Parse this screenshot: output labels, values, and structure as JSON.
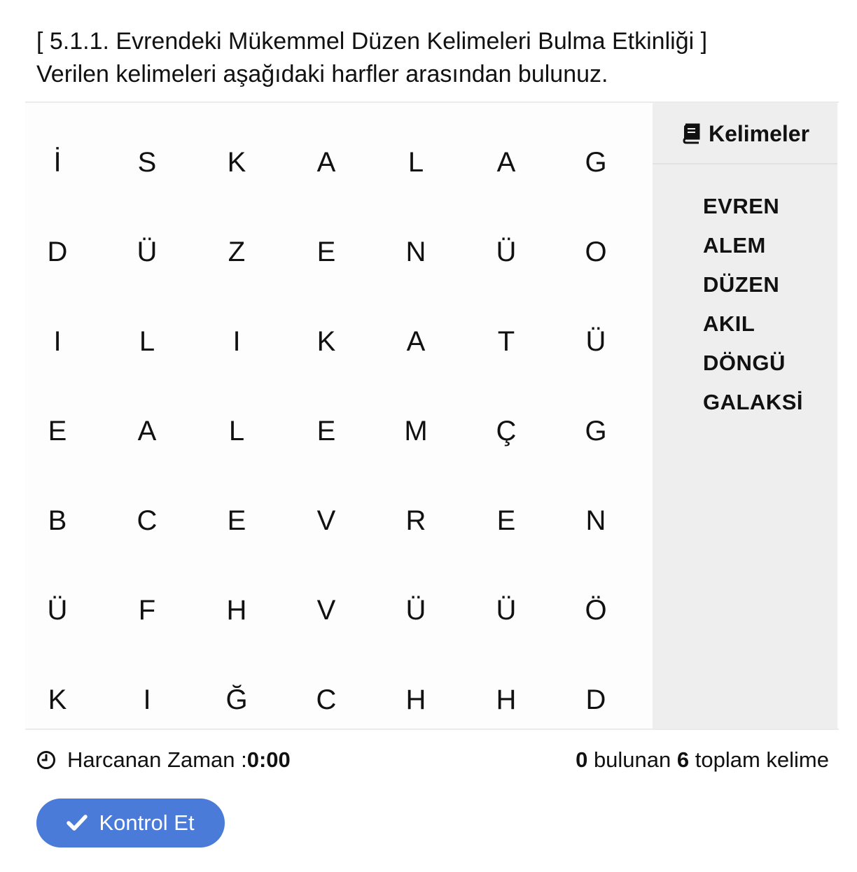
{
  "header": {
    "title": "[ 5.1.1. Evrendeki Mükemmel Düzen Kelimeleri Bulma Etkinliği ]",
    "instruction": "Verilen kelimeleri aşağıdaki harfler arasından bulunuz."
  },
  "grid": {
    "rows": [
      [
        "İ",
        "S",
        "K",
        "A",
        "L",
        "A",
        "G"
      ],
      [
        "D",
        "Ü",
        "Z",
        "E",
        "N",
        "Ü",
        "O"
      ],
      [
        "I",
        "L",
        "I",
        "K",
        "A",
        "T",
        "Ü"
      ],
      [
        "E",
        "A",
        "L",
        "E",
        "M",
        "Ç",
        "G"
      ],
      [
        "B",
        "C",
        "E",
        "V",
        "R",
        "E",
        "N"
      ],
      [
        "Ü",
        "F",
        "H",
        "V",
        "Ü",
        "Ü",
        "Ö"
      ],
      [
        "K",
        "I",
        "Ğ",
        "C",
        "H",
        "H",
        "D"
      ]
    ]
  },
  "sidebar": {
    "title": "Kelimeler",
    "icon": "book-icon",
    "words": [
      "EVREN",
      "ALEM",
      "DÜZEN",
      "AKIL",
      "DÖNGÜ",
      "GALAKSİ"
    ]
  },
  "footer": {
    "time_label": "Harcanan Zaman : ",
    "time_value": "0:00",
    "found_count": "0",
    "found_label": " bulunan ",
    "total_count": "6",
    "total_label": " toplam kelime"
  },
  "button": {
    "label": "Kontrol Et",
    "color": "#4a7bd8"
  }
}
